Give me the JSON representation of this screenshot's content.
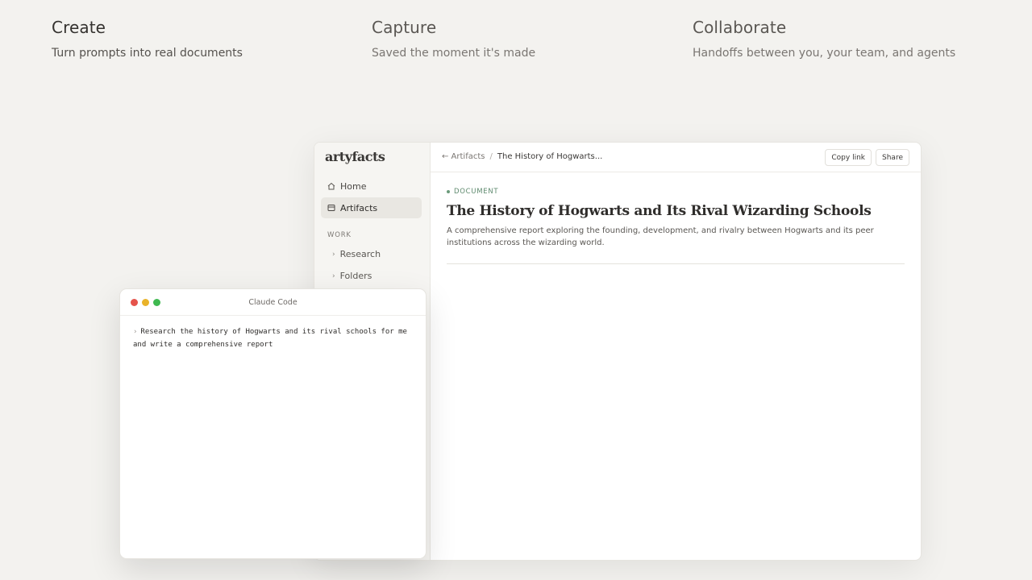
{
  "features": [
    {
      "title": "Create",
      "subtitle": "Turn prompts into real documents"
    },
    {
      "title": "Capture",
      "subtitle": "Saved the moment it's made"
    },
    {
      "title": "Collaborate",
      "subtitle": "Handoffs between you, your team, and agents"
    }
  ],
  "app": {
    "logo": "artyfacts",
    "nav": [
      {
        "label": "Home",
        "icon": "home-icon"
      },
      {
        "label": "Artifacts",
        "icon": "artifacts-icon",
        "active": true
      }
    ],
    "section_label": "WORK",
    "tree": [
      {
        "label": "Research",
        "icon": "chevron-right-icon"
      },
      {
        "label": "Folders",
        "icon": "chevron-right-icon"
      }
    ],
    "breadcrumb": {
      "back": "← Artifacts",
      "separator": "/",
      "current": "The History of Hogwarts..."
    },
    "buttons": {
      "copy_link": "Copy link",
      "share": "Share"
    },
    "document": {
      "tag": "DOCUMENT",
      "title": "The History of Hogwarts and Its Rival Wizarding Schools",
      "description": "A comprehensive report exploring the founding, development, and rivalry between Hogwarts and its peer institutions across the wizarding world."
    }
  },
  "terminal": {
    "title": "Claude Code",
    "prompt_symbol": "›",
    "command": "Research the history of Hogwarts and its rival schools for me and write a comprehensive report",
    "dot_colors": [
      "#e5534b",
      "#e9b32a",
      "#3fb950"
    ]
  }
}
